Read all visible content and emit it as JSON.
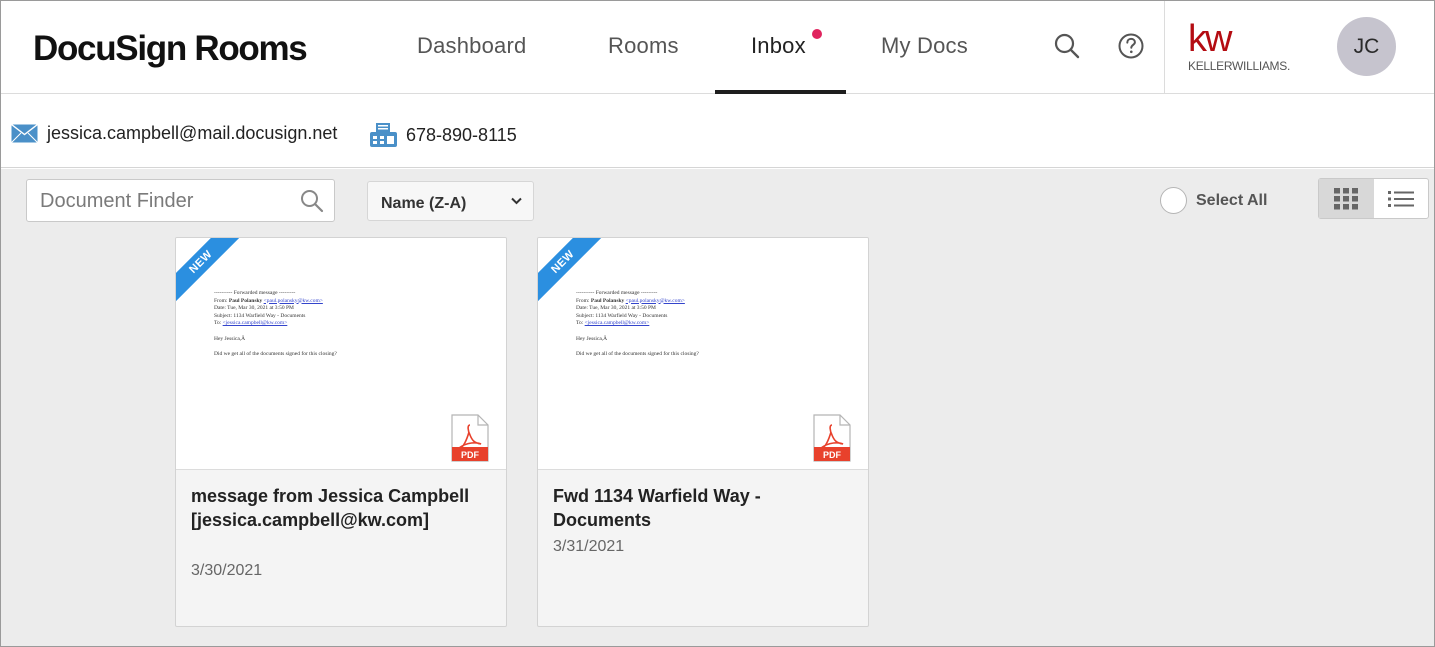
{
  "header": {
    "brand": "DocuSign Rooms",
    "tabs": [
      {
        "label": "Dashboard"
      },
      {
        "label": "Rooms"
      },
      {
        "label": "Inbox"
      },
      {
        "label": "My Docs"
      }
    ],
    "active_tab": "Inbox",
    "inbox_notification": true,
    "partner_logo": {
      "mark": "kw",
      "text": "KELLERWILLIAMS."
    },
    "avatar_initials": "JC"
  },
  "contact": {
    "email": "jessica.campbell@mail.docusign.net",
    "fax": "678-890-8115"
  },
  "toolbar": {
    "finder_placeholder": "Document Finder",
    "sort_value": "Name (Z-A)",
    "select_all_label": "Select All",
    "view_mode": "grid"
  },
  "documents": [
    {
      "badge": "NEW",
      "title": "message from Jessica Campbell [jessica.campbell@kw.com]",
      "date": "3/30/2021",
      "file_type": "PDF",
      "preview": {
        "line1": "---------- Forwarded message ---------",
        "from_label": "From: ",
        "from_name": "Paul Polansky",
        "from_email": "<paul.polansky@kw.com>",
        "date_line": "Date: Tue, Mar 30, 2021 at 3:50 PM",
        "subject_line": "Subject: 1134 Warfield Way - Documents",
        "to_label": "To: ",
        "to_email": "<jessica.campbell@kw.com>",
        "greeting": "Hey Jessica,Â",
        "body": "Did we get all of the documents signed for this closing?"
      }
    },
    {
      "badge": "NEW",
      "title": "Fwd 1134 Warfield Way - Documents",
      "date": "3/31/2021",
      "file_type": "PDF",
      "preview": {
        "line1": "---------- Forwarded message ---------",
        "from_label": "From: ",
        "from_name": "Paul Polansky",
        "from_email": "<paul.polansky@kw.com>",
        "date_line": "Date: Tue, Mar 30, 2021 at 3:50 PM",
        "subject_line": "Subject: 1134 Warfield Way - Documents",
        "to_label": "To: ",
        "to_email": "<jessica.campbell@kw.com>",
        "greeting": "Hey Jessica,Â",
        "body": "Did we get all of the documents signed for this closing?"
      }
    }
  ],
  "colors": {
    "accent_dot": "#e0245e",
    "ribbon": "#2b8fe0",
    "kw_red": "#b40c12",
    "pdf_red": "#e8412c",
    "contact_icon": "#4a90c8"
  },
  "icons": [
    "search-icon",
    "help-icon",
    "email-icon",
    "fax-icon",
    "chevron-down-icon",
    "grid-view-icon",
    "list-view-icon",
    "pdf-icon"
  ]
}
